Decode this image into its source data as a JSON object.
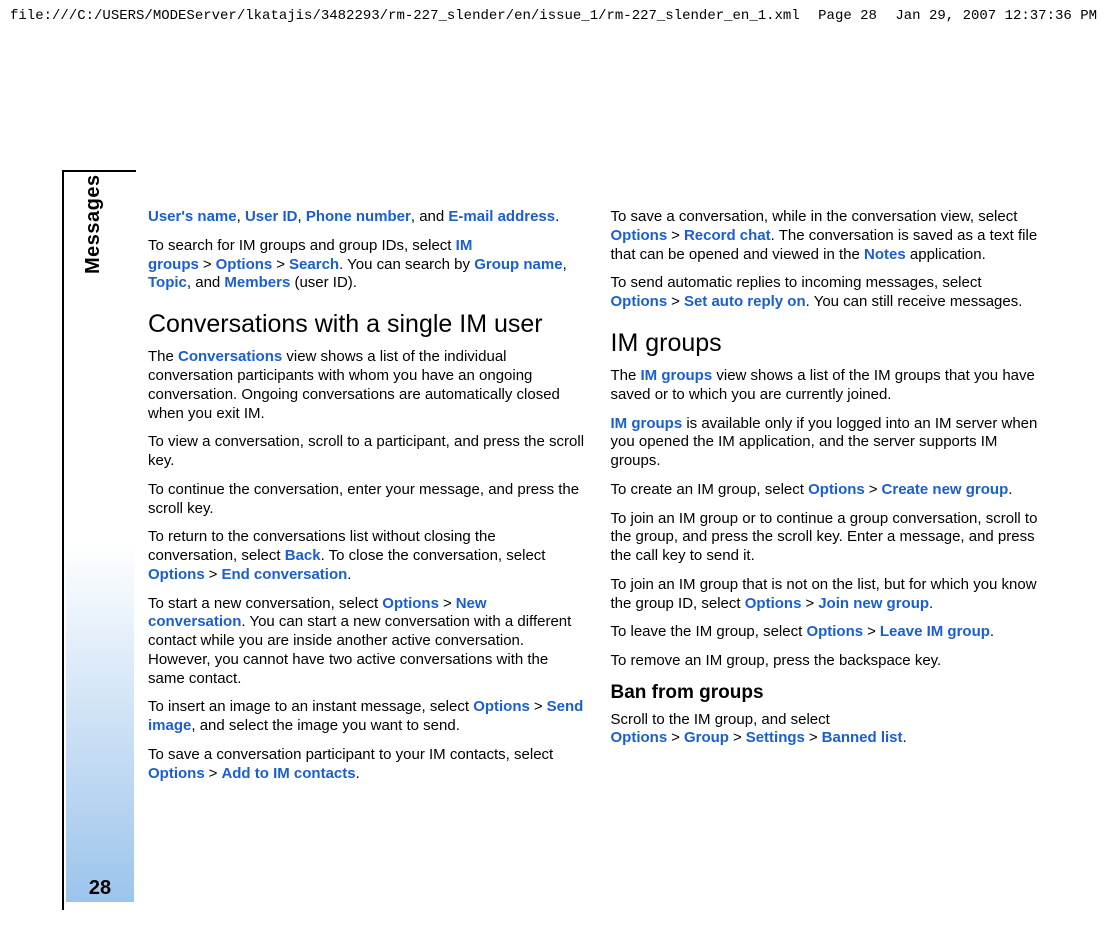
{
  "header": {
    "path": "file:///C:/USERS/MODEServer/lkatajis/3482293/rm-227_slender/en/issue_1/rm-227_slender_en_1.xml",
    "page": "Page 28",
    "datetime": "Jan 29, 2007 12:37:36 PM"
  },
  "side": {
    "tab": "Messages",
    "page_num": "28"
  },
  "gt": ">",
  "body": {
    "p1_a": "User's name",
    "p1_b": "User ID",
    "p1_c": "Phone number",
    "p1_d": "E-mail address",
    "p1_t1": ", ",
    "p1_t2": ", ",
    "p1_t3": ", and ",
    "p1_t4": ".",
    "p2_t1": "To search for IM groups and group IDs, select ",
    "p2_a": "IM groups",
    "p2_b": "Options",
    "p2_c": "Search",
    "p2_t2": ". You can search by ",
    "p2_d": "Group name",
    "p2_t3": ", ",
    "p2_e": "Topic",
    "p2_t4": ", and ",
    "p2_f": "Members",
    "p2_t5": " (user ID).",
    "h2a": "Conversations with a single IM user",
    "p3_t1": "The ",
    "p3_a": "Conversations",
    "p3_t2": " view shows a list of the individual conversation participants with whom you have an ongoing conversation. Ongoing conversations are automatically closed when you exit IM.",
    "p4": "To view a conversation, scroll to a participant, and press the scroll key.",
    "p5": "To continue the conversation, enter your message, and press the scroll key.",
    "p6_t1": "To return to the conversations list without closing the conversation, select ",
    "p6_a": "Back",
    "p6_t2": ". To close the conversation, select ",
    "p6_b": "Options",
    "p6_c": "End conversation",
    "p6_t3": ".",
    "p7_t1": "To start a new conversation, select ",
    "p7_a": "Options",
    "p7_b": "New conversation",
    "p7_t2": ". You can start a new conversation with a different contact while you are inside another active conversation. However, you cannot have two active conversations with the same contact.",
    "p8_t1": "To insert an image to an instant message, select ",
    "p8_a": "Options",
    "p8_b": "Send image",
    "p8_t2": ", and select the image you want to send.",
    "p9_t1": "To save a conversation participant to your IM contacts, select ",
    "p9_a": "Options",
    "p9_b": "Add to IM contacts",
    "p9_t2": ".",
    "p10_t1": "To save a conversation, while in the conversation view, select ",
    "p10_a": "Options",
    "p10_b": "Record chat",
    "p10_t2": ". The conversation is saved as a text file that can be opened and viewed in the ",
    "p10_c": "Notes",
    "p10_t3": " application.",
    "p11_t1": "To send automatic replies to incoming messages, select ",
    "p11_a": "Options",
    "p11_b": "Set auto reply on",
    "p11_t2": ". You can still receive messages.",
    "h2b": "IM groups",
    "p12_t1": "The ",
    "p12_a": "IM groups",
    "p12_t2": " view shows a list of the IM groups that you have saved or to which you are currently joined.",
    "p13_a": "IM groups",
    "p13_t1": " is available only if you logged into an IM server when you opened the IM application, and the server supports IM groups.",
    "p14_t1": "To create an IM group, select ",
    "p14_a": "Options",
    "p14_b": "Create new group",
    "p14_t2": ".",
    "p15": "To join an IM group or to continue a group conversation, scroll to the group, and press the scroll key. Enter a message, and press the call key to send it.",
    "p16_t1": "To join an IM group that is not on the list, but for which you know the group ID, select ",
    "p16_a": "Options",
    "p16_b": "Join new group",
    "p16_t2": ".",
    "p17_t1": "To leave the IM group, select ",
    "p17_a": "Options",
    "p17_b": "Leave IM group",
    "p17_t2": ".",
    "p18": "To remove an IM group, press the backspace key.",
    "h3a": "Ban from groups",
    "p19_t1": "Scroll to the IM group, and select ",
    "p19_a": "Options",
    "p19_b": "Group",
    "p19_c": "Settings",
    "p19_d": "Banned list",
    "p19_t2": "."
  }
}
